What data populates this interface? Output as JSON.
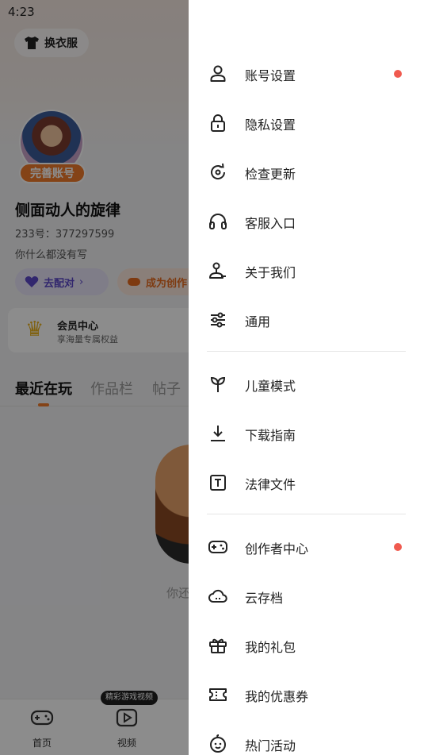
{
  "status_bar": {
    "time": "4:23"
  },
  "background": {
    "outfit_button": "换衣服",
    "complete_badge": "完善账号",
    "username": "侧面动人的旋律",
    "user_id": "233号：377297599",
    "bio": "你什么都没有写",
    "match_button": "去配对",
    "creator_button": "成为创作",
    "vip": {
      "title": "会员中心",
      "subtitle": "享海量专属权益"
    },
    "tabs": [
      "最近在玩",
      "作品栏",
      "帖子"
    ],
    "empty_text": "你还",
    "bottom_nav": {
      "home": "首页",
      "video": "视频",
      "tip": "精彩游戏视频"
    }
  },
  "drawer": {
    "items": [
      {
        "label": "账号设置",
        "icon": "user-icon",
        "dot": true
      },
      {
        "label": "隐私设置",
        "icon": "lock-icon",
        "dot": false
      },
      {
        "label": "检查更新",
        "icon": "refresh-icon",
        "dot": false
      },
      {
        "label": "客服入口",
        "icon": "headset-icon",
        "dot": false
      },
      {
        "label": "关于我们",
        "icon": "about-icon",
        "dot": false
      },
      {
        "label": "通用",
        "icon": "sliders-icon",
        "dot": false
      },
      {
        "label": "儿童模式",
        "icon": "sprout-icon",
        "dot": false
      },
      {
        "label": "下载指南",
        "icon": "download-icon",
        "dot": false
      },
      {
        "label": "法律文件",
        "icon": "document-icon",
        "dot": false
      },
      {
        "label": "创作者中心",
        "icon": "gamepad-icon",
        "dot": true
      },
      {
        "label": "云存档",
        "icon": "cloud-icon",
        "dot": false
      },
      {
        "label": "我的礼包",
        "icon": "gift-icon",
        "dot": false
      },
      {
        "label": "我的优惠券",
        "icon": "coupon-icon",
        "dot": false
      },
      {
        "label": "热门活动",
        "icon": "smile-icon",
        "dot": false
      }
    ]
  },
  "colors": {
    "accent": "#f07a2a",
    "dot": "#f05a4f",
    "overlay": "rgba(0,0,0,0.45)"
  }
}
